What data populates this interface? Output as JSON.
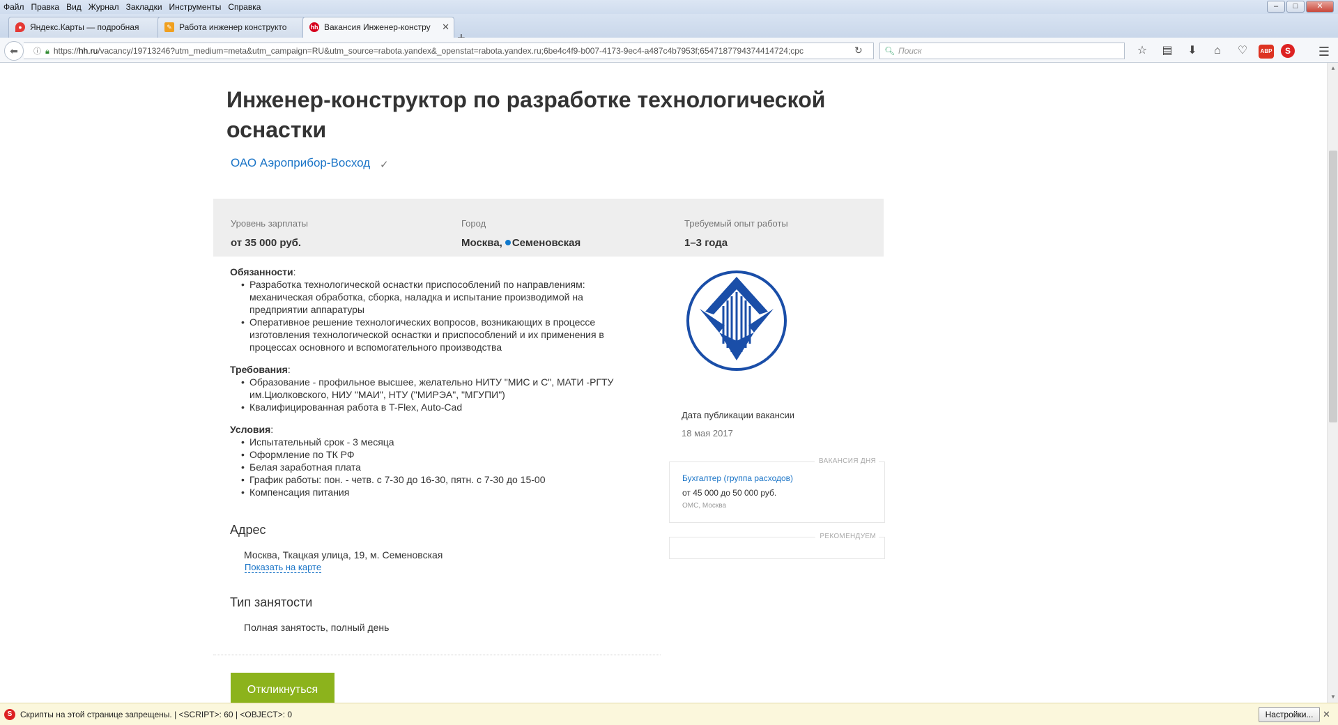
{
  "menubar": {
    "items": [
      "Файл",
      "Правка",
      "Вид",
      "Журнал",
      "Закладки",
      "Инструменты",
      "Справка"
    ]
  },
  "window_controls": {
    "minimize": "–",
    "maximize": "□",
    "close": "✕"
  },
  "tabs": [
    {
      "label": "Яндекс.Карты — подробная",
      "icon": "map-pin-icon",
      "icon_color": "#e53935"
    },
    {
      "label": "Работа инженер конструкто",
      "icon": "page-icon",
      "icon_color": "#7a7a7a"
    },
    {
      "label": "Вакансия Инженер-констру",
      "icon": "hh-icon",
      "icon_color": "#d6001c",
      "active": true
    }
  ],
  "new_tab": "+",
  "address_bar": {
    "url_prefix": "https://",
    "url_domain": "hh.ru",
    "url_rest": "/vacancy/19713246?utm_medium=meta&utm_campaign=RU&utm_source=rabota.yandex&_openstat=rabota.yandex.ru;6be4c4f9-b007-4173-9ec4-a487c4b7953f;6547187794374414724;cpc"
  },
  "search_bar": {
    "placeholder": "Поиск"
  },
  "toolbar": {
    "abp_label": "ABP",
    "noscript_label": "S"
  },
  "page": {
    "title": "Инженер-конструктор по разработке технологической оснастки",
    "company": "ОАО Аэроприбор-Восход",
    "verified_mark": "✓",
    "salary_label": "Уровень зарплаты",
    "salary_value": "от 35 000 руб.",
    "city_label": "Город",
    "city_value": "Москва,",
    "metro_value": "Семеновская",
    "metro_color": "#0f78cc",
    "experience_label": "Требуемый опыт работы",
    "experience_value": "1–3 года",
    "duties_heading": "Обязанности",
    "duties": [
      "Разработка технологической оснастки приспособлений по направлениям: механическая обработка, сборка, наладка и испытание производимой на предприятии аппаратуры",
      "Оперативное решение технологических вопросов, возникающих в процессе изготовления технологической оснастки и приспособлений и их применения в процессах основного и вспомогательного производства"
    ],
    "requirements_heading": "Требования",
    "requirements": [
      "Образование - профильное высшее, желательно НИТУ \"МИС и С\", МАТИ -РГТУ им.Циолковского, НИУ \"МАИ\", НТУ (\"МИРЭА\", \"МГУПИ\")",
      "Квалифицированная работа в T-Flex, Auto-Cad"
    ],
    "conditions_heading": "Условия",
    "conditions": [
      "Испытательный срок - 3 месяца",
      "Оформление по ТК РФ",
      "Белая заработная плата",
      "График работы: пон. - четв. с 7-30 до 16-30, пятн. с 7-30 до 15-00",
      "Компенсация питания"
    ],
    "address_heading": "Адрес",
    "address_value": "Москва, Ткацкая улица, 19, м. Семеновская",
    "map_link": "Показать на карте",
    "employment_heading": "Тип занятости",
    "employment_value": "Полная занятость, полный день",
    "respond_button": "Откликнуться",
    "publication_label": "Дата публикации вакансии",
    "publication_date": "18 мая 2017",
    "logo_color": "#1a4ea8",
    "vacancy_of_day": {
      "title": "ВАКАНСИЯ ДНЯ",
      "link": "Бухгалтер (группа расходов)",
      "salary": "от 45 000 до 50 000 руб.",
      "meta": "ОМС, Москва"
    },
    "recommended_title": "РЕКОМЕНДУЕМ"
  },
  "notification": {
    "text": "Скрипты на этой странице запрещены. | <SCRIPT>: 60 | <OBJECT>: 0",
    "settings_button": "Настройки...",
    "close": "✕"
  }
}
